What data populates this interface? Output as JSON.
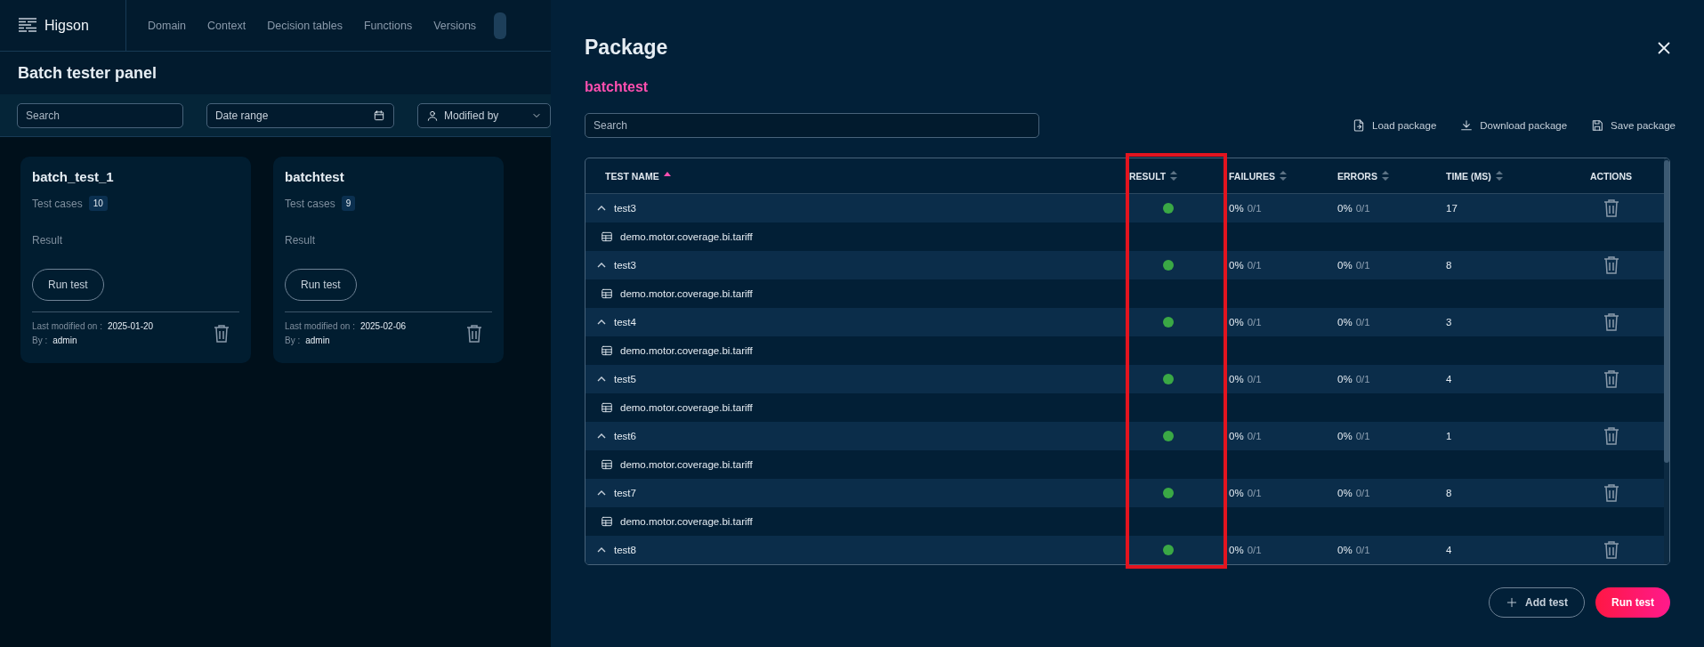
{
  "app": {
    "logo": "Higson",
    "nav": [
      "Domain",
      "Context",
      "Decision tables",
      "Functions",
      "Versions"
    ]
  },
  "page": {
    "title": "Batch tester panel",
    "filters": {
      "search": {
        "placeholder": "Search"
      },
      "date_range": {
        "placeholder": "Date range"
      },
      "modified_by": {
        "placeholder": "Modified by"
      }
    },
    "packages": [
      {
        "name": "batch_test_1",
        "test_cases_label": "Test cases",
        "test_cases": "10",
        "result_label": "Result",
        "run_button": "Run test",
        "modified_label": "Last modified on :",
        "modified": "2025-01-20",
        "by_label": "By :",
        "by": "admin"
      },
      {
        "name": "batchtest",
        "test_cases_label": "Test cases",
        "test_cases": "9",
        "result_label": "Result",
        "run_button": "Run test",
        "modified_label": "Last modified on :",
        "modified": "2025-02-06",
        "by_label": "By :",
        "by": "admin"
      }
    ]
  },
  "dialog": {
    "title": "Package",
    "package_name": "batchtest",
    "search": {
      "placeholder": "Search"
    },
    "actions": [
      {
        "kind": "load",
        "label": "Load package"
      },
      {
        "kind": "download",
        "label": "Download package"
      },
      {
        "kind": "save",
        "label": "Save package"
      }
    ],
    "table": {
      "columns": [
        {
          "label": "TEST NAME",
          "sorted": true,
          "highlighted": false
        },
        {
          "label": "RESULT",
          "sorted": false,
          "highlighted": true
        },
        {
          "label": "FAILURES",
          "sorted": false,
          "highlighted": false
        },
        {
          "label": "ERRORS",
          "sorted": false,
          "highlighted": false
        },
        {
          "label": "TIME (MS)",
          "sorted": false,
          "highlighted": false
        },
        {
          "label": "ACTIONS",
          "highlighted": false
        }
      ],
      "rows": [
        {
          "name": "test3",
          "expanded": true,
          "passed": true,
          "failures": "0%",
          "failures_count": "0/1",
          "errors": "0%",
          "errors_count": "0/1",
          "time": "17",
          "children": [
            {
              "name": "demo.motor.coverage.bi.tariff"
            }
          ]
        },
        {
          "name": "test3",
          "expanded": true,
          "passed": true,
          "failures": "0%",
          "failures_count": "0/1",
          "errors": "0%",
          "errors_count": "0/1",
          "time": "8",
          "children": [
            {
              "name": "demo.motor.coverage.bi.tariff"
            }
          ]
        },
        {
          "name": "test4",
          "expanded": true,
          "passed": true,
          "failures": "0%",
          "failures_count": "0/1",
          "errors": "0%",
          "errors_count": "0/1",
          "time": "3",
          "children": [
            {
              "name": "demo.motor.coverage.bi.tariff"
            }
          ]
        },
        {
          "name": "test5",
          "expanded": true,
          "passed": true,
          "failures": "0%",
          "failures_count": "0/1",
          "errors": "0%",
          "errors_count": "0/1",
          "time": "4",
          "children": [
            {
              "name": "demo.motor.coverage.bi.tariff"
            }
          ]
        },
        {
          "name": "test6",
          "expanded": true,
          "passed": true,
          "failures": "0%",
          "failures_count": "0/1",
          "errors": "0%",
          "errors_count": "0/1",
          "time": "1",
          "children": [
            {
              "name": "demo.motor.coverage.bi.tariff"
            }
          ]
        },
        {
          "name": "test7",
          "expanded": true,
          "passed": true,
          "failures": "0%",
          "failures_count": "0/1",
          "errors": "0%",
          "errors_count": "0/1",
          "time": "8",
          "children": [
            {
              "name": "demo.motor.coverage.bi.tariff"
            }
          ]
        },
        {
          "name": "test8",
          "expanded": true,
          "passed": true,
          "failures": "0%",
          "failures_count": "0/1",
          "errors": "0%",
          "errors_count": "0/1",
          "time": "4"
        }
      ]
    },
    "buttons": [
      {
        "kind": "secondary",
        "label": "Add test"
      },
      {
        "kind": "primary",
        "label": "Run test"
      }
    ]
  }
}
